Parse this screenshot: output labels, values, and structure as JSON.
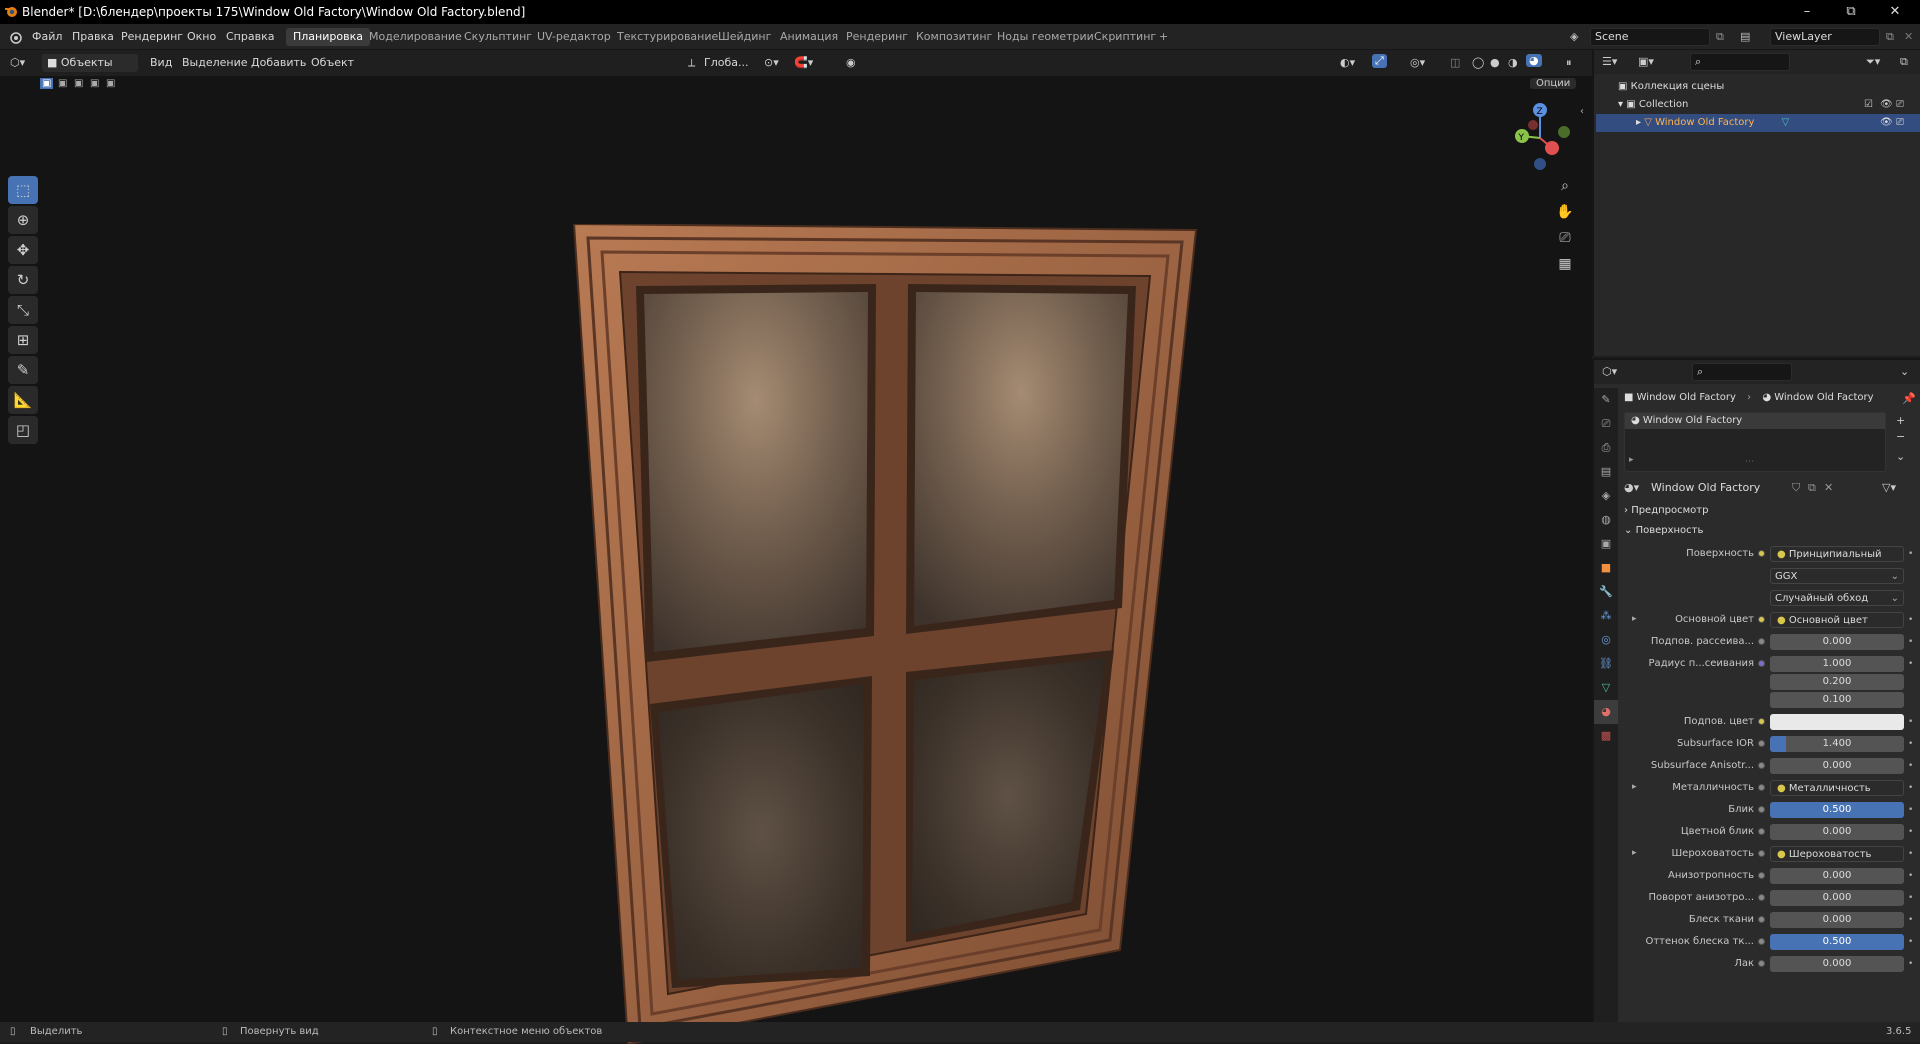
{
  "title_bar": {
    "title": "Blender* [D:\\блендер\\проекты 175\\Window Old Factory\\Window Old Factory.blend]",
    "minimize": "–",
    "maximize": "⧉",
    "close": "✕"
  },
  "menus": [
    "Файл",
    "Правка",
    "Рендеринг",
    "Окно",
    "Справка"
  ],
  "workspaces": [
    "Планировка",
    "Моделирование",
    "Скульптинг",
    "UV-редактор",
    "Текстурирование",
    "Шейдинг",
    "Анимация",
    "Рендеринг",
    "Композитинг",
    "Ноды геометрии",
    "Скриптинг"
  ],
  "active_workspace": "Планировка",
  "add_workspace": "+",
  "scene": "Scene",
  "view_layer": "ViewLayer",
  "viewport_header": {
    "mode": "Объекты",
    "menus": [
      "Вид",
      "Выделение",
      "Добавить",
      "Объект"
    ],
    "transform": "Глоба...",
    "options": "Опции"
  },
  "outliner": {
    "root": "Коллекция сцены",
    "collection": "Collection",
    "object": "Window Old Factory"
  },
  "properties": {
    "breadcrumb_object": "Window Old Factory",
    "breadcrumb_material": "Window Old Factory",
    "slot": "Window Old Factory",
    "material_name": "Window Old Factory",
    "panel_preview": "Предпросмотр",
    "panel_surface": "Поверхность",
    "rows": [
      {
        "label": "Поверхность",
        "value": "Принципиальный BSDF",
        "kind": "link",
        "dot": "y"
      },
      {
        "label": "",
        "value": "GGX",
        "kind": "drop",
        "dot": ""
      },
      {
        "label": "",
        "value": "Случайный обход",
        "kind": "drop",
        "dot": ""
      },
      {
        "label": "Основной цвет",
        "value": "Основной цвет",
        "kind": "link",
        "dot": "y",
        "expand": true
      },
      {
        "label": "Подпов. рассеива...",
        "value": "0.000",
        "kind": "num",
        "dot": "g"
      },
      {
        "label": "Радиус п...сеивания",
        "value": "1.000",
        "kind": "num",
        "dot": "p"
      },
      {
        "label": "",
        "value": "0.200",
        "kind": "num",
        "dot": ""
      },
      {
        "label": "",
        "value": "0.100",
        "kind": "num",
        "dot": ""
      },
      {
        "label": "Подпов. цвет",
        "value": "",
        "kind": "white",
        "dot": "y"
      },
      {
        "label": "Subsurface IOR",
        "value": "1.400",
        "kind": "fill",
        "fill": 0.12,
        "dot": "g"
      },
      {
        "label": "Subsurface Anisotr...",
        "value": "0.000",
        "kind": "num",
        "dot": "g"
      },
      {
        "label": "Металличность",
        "value": "Металличность",
        "kind": "link",
        "dot": "g",
        "expand": true
      },
      {
        "label": "Блик",
        "value": "0.500",
        "kind": "fill",
        "fill": 1.0,
        "dot": "g"
      },
      {
        "label": "Цветной блик",
        "value": "0.000",
        "kind": "num",
        "dot": "g"
      },
      {
        "label": "Шероховатость",
        "value": "Шероховатость",
        "kind": "link",
        "dot": "g",
        "expand": true
      },
      {
        "label": "Анизотропность",
        "value": "0.000",
        "kind": "num",
        "dot": "g"
      },
      {
        "label": "Поворот анизотро...",
        "value": "0.000",
        "kind": "num",
        "dot": "g"
      },
      {
        "label": "Блеск ткани",
        "value": "0.000",
        "kind": "num",
        "dot": "g"
      },
      {
        "label": "Оттенок блеска тк...",
        "value": "0.500",
        "kind": "fill",
        "fill": 1.0,
        "dot": "g"
      },
      {
        "label": "Лак",
        "value": "0.000",
        "kind": "num",
        "dot": "g"
      }
    ]
  },
  "status_bar": {
    "select": "Выделить",
    "rotate": "Повернуть вид",
    "context": "Контекстное меню объектов",
    "version": "3.6.5"
  }
}
